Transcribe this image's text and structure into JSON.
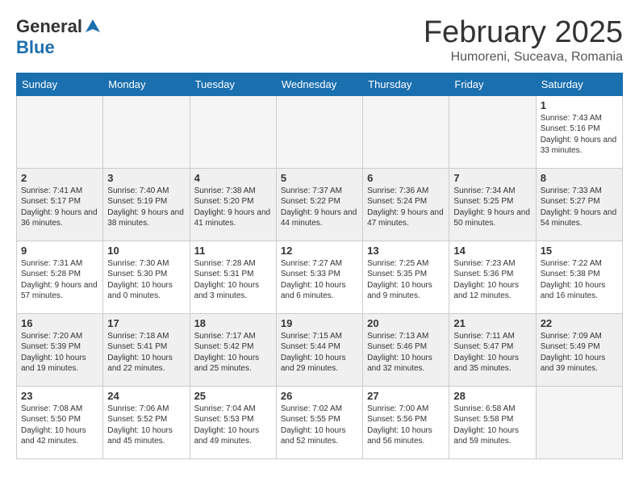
{
  "header": {
    "logo_general": "General",
    "logo_blue": "Blue",
    "month_year": "February 2025",
    "location": "Humoreni, Suceava, Romania"
  },
  "weekdays": [
    "Sunday",
    "Monday",
    "Tuesday",
    "Wednesday",
    "Thursday",
    "Friday",
    "Saturday"
  ],
  "weeks": [
    [
      {
        "day": "",
        "empty": true
      },
      {
        "day": "",
        "empty": true
      },
      {
        "day": "",
        "empty": true
      },
      {
        "day": "",
        "empty": true
      },
      {
        "day": "",
        "empty": true
      },
      {
        "day": "",
        "empty": true
      },
      {
        "day": "1",
        "sunrise": "7:43 AM",
        "sunset": "5:16 PM",
        "daylight": "Daylight: 9 hours and 33 minutes."
      }
    ],
    [
      {
        "day": "2",
        "sunrise": "7:41 AM",
        "sunset": "5:17 PM",
        "daylight": "Daylight: 9 hours and 36 minutes."
      },
      {
        "day": "3",
        "sunrise": "7:40 AM",
        "sunset": "5:19 PM",
        "daylight": "Daylight: 9 hours and 38 minutes."
      },
      {
        "day": "4",
        "sunrise": "7:38 AM",
        "sunset": "5:20 PM",
        "daylight": "Daylight: 9 hours and 41 minutes."
      },
      {
        "day": "5",
        "sunrise": "7:37 AM",
        "sunset": "5:22 PM",
        "daylight": "Daylight: 9 hours and 44 minutes."
      },
      {
        "day": "6",
        "sunrise": "7:36 AM",
        "sunset": "5:24 PM",
        "daylight": "Daylight: 9 hours and 47 minutes."
      },
      {
        "day": "7",
        "sunrise": "7:34 AM",
        "sunset": "5:25 PM",
        "daylight": "Daylight: 9 hours and 50 minutes."
      },
      {
        "day": "8",
        "sunrise": "7:33 AM",
        "sunset": "5:27 PM",
        "daylight": "Daylight: 9 hours and 54 minutes."
      }
    ],
    [
      {
        "day": "9",
        "sunrise": "7:31 AM",
        "sunset": "5:28 PM",
        "daylight": "Daylight: 9 hours and 57 minutes."
      },
      {
        "day": "10",
        "sunrise": "7:30 AM",
        "sunset": "5:30 PM",
        "daylight": "Daylight: 10 hours and 0 minutes."
      },
      {
        "day": "11",
        "sunrise": "7:28 AM",
        "sunset": "5:31 PM",
        "daylight": "Daylight: 10 hours and 3 minutes."
      },
      {
        "day": "12",
        "sunrise": "7:27 AM",
        "sunset": "5:33 PM",
        "daylight": "Daylight: 10 hours and 6 minutes."
      },
      {
        "day": "13",
        "sunrise": "7:25 AM",
        "sunset": "5:35 PM",
        "daylight": "Daylight: 10 hours and 9 minutes."
      },
      {
        "day": "14",
        "sunrise": "7:23 AM",
        "sunset": "5:36 PM",
        "daylight": "Daylight: 10 hours and 12 minutes."
      },
      {
        "day": "15",
        "sunrise": "7:22 AM",
        "sunset": "5:38 PM",
        "daylight": "Daylight: 10 hours and 16 minutes."
      }
    ],
    [
      {
        "day": "16",
        "sunrise": "7:20 AM",
        "sunset": "5:39 PM",
        "daylight": "Daylight: 10 hours and 19 minutes."
      },
      {
        "day": "17",
        "sunrise": "7:18 AM",
        "sunset": "5:41 PM",
        "daylight": "Daylight: 10 hours and 22 minutes."
      },
      {
        "day": "18",
        "sunrise": "7:17 AM",
        "sunset": "5:42 PM",
        "daylight": "Daylight: 10 hours and 25 minutes."
      },
      {
        "day": "19",
        "sunrise": "7:15 AM",
        "sunset": "5:44 PM",
        "daylight": "Daylight: 10 hours and 29 minutes."
      },
      {
        "day": "20",
        "sunrise": "7:13 AM",
        "sunset": "5:46 PM",
        "daylight": "Daylight: 10 hours and 32 minutes."
      },
      {
        "day": "21",
        "sunrise": "7:11 AM",
        "sunset": "5:47 PM",
        "daylight": "Daylight: 10 hours and 35 minutes."
      },
      {
        "day": "22",
        "sunrise": "7:09 AM",
        "sunset": "5:49 PM",
        "daylight": "Daylight: 10 hours and 39 minutes."
      }
    ],
    [
      {
        "day": "23",
        "sunrise": "7:08 AM",
        "sunset": "5:50 PM",
        "daylight": "Daylight: 10 hours and 42 minutes."
      },
      {
        "day": "24",
        "sunrise": "7:06 AM",
        "sunset": "5:52 PM",
        "daylight": "Daylight: 10 hours and 45 minutes."
      },
      {
        "day": "25",
        "sunrise": "7:04 AM",
        "sunset": "5:53 PM",
        "daylight": "Daylight: 10 hours and 49 minutes."
      },
      {
        "day": "26",
        "sunrise": "7:02 AM",
        "sunset": "5:55 PM",
        "daylight": "Daylight: 10 hours and 52 minutes."
      },
      {
        "day": "27",
        "sunrise": "7:00 AM",
        "sunset": "5:56 PM",
        "daylight": "Daylight: 10 hours and 56 minutes."
      },
      {
        "day": "28",
        "sunrise": "6:58 AM",
        "sunset": "5:58 PM",
        "daylight": "Daylight: 10 hours and 59 minutes."
      },
      {
        "day": "",
        "empty": true
      }
    ]
  ]
}
